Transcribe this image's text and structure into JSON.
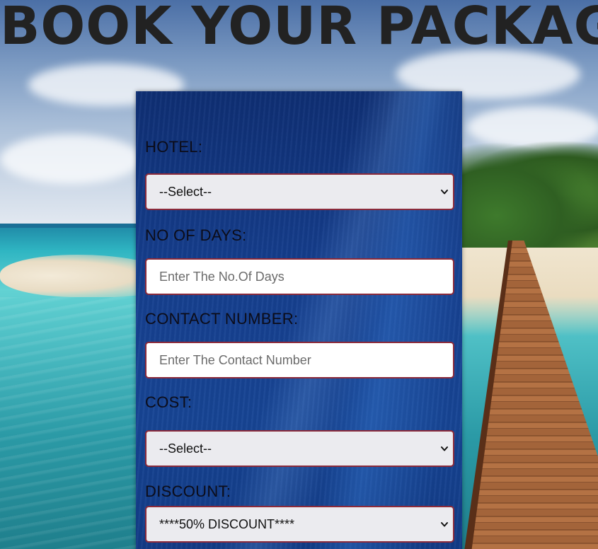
{
  "page": {
    "title": "BOOK YOUR PACKAGE"
  },
  "form": {
    "hotel": {
      "label": "HOTEL:",
      "selected": "--Select--"
    },
    "days": {
      "label": "NO OF DAYS:",
      "placeholder": "Enter The No.Of Days",
      "value": ""
    },
    "contact": {
      "label": "CONTACT NUMBER:",
      "placeholder": "Enter The Contact Number",
      "value": ""
    },
    "cost": {
      "label": "COST:",
      "selected": "--Select--"
    },
    "discount": {
      "label": "DISCOUNT:",
      "selected": "****50% DISCOUNT****"
    }
  },
  "colors": {
    "panel": "#163f8f",
    "field_border": "#8b2a3a",
    "select_bg": "#ebebef",
    "heading_text": "#222222"
  },
  "icons": {
    "select_arrow": "chevron-down-icon"
  }
}
